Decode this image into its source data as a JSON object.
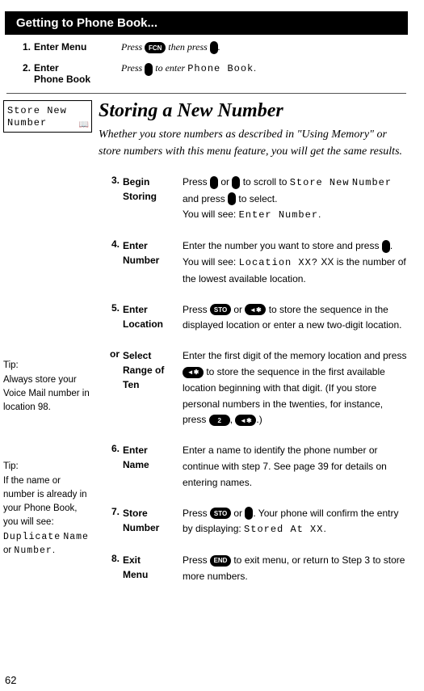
{
  "header": {
    "title": "Getting to Phone Book..."
  },
  "intro_steps": [
    {
      "num": "1.",
      "label": "Enter Menu",
      "desc_pre": "Press ",
      "btn1": "FCN",
      "mid": " then press ",
      "end": "."
    },
    {
      "num": "2.",
      "label_line1": "Enter",
      "label_line2": "Phone Book",
      "desc_pre": "Press ",
      "mid": " to enter ",
      "lcd": "Phone Book",
      "end": "."
    }
  ],
  "sidebar": {
    "box_line1": "Store New",
    "box_line2": "Number",
    "book_icon": "book-icon"
  },
  "tips": {
    "tip1_title": "Tip:",
    "tip1_body": "Always store your Voice Mail number in location 98.",
    "tip2_title": "Tip:",
    "tip2_body_pre": "If the name or number is already in your Phone Book, you will see:",
    "tip2_lcd1": "Duplicate",
    "tip2_lcd2": "Name",
    "tip2_or": " or ",
    "tip2_lcd3": "Number",
    "tip2_body_end": "."
  },
  "main": {
    "title": "Storing a New Number",
    "subtitle": "Whether you store numbers as described in \"Using Memory\" or store numbers with this menu feature, you will get the same results."
  },
  "steps": {
    "s3": {
      "num": "3.",
      "label1": "Begin",
      "label2": "Storing",
      "d1": "Press ",
      "d2": " or ",
      "d3": " to scroll to ",
      "lcd1": "Store New",
      "lcd2": "Number",
      "d4": " and press ",
      "d5": " to select.",
      "d6": "You will see: ",
      "lcd3": "Enter Number",
      "d7": "."
    },
    "s4": {
      "num": "4.",
      "label1": "Enter",
      "label2": "Number",
      "d1": "Enter the number you want to store and press ",
      "d2": ". You will see: ",
      "lcd1": "Location XX?",
      "d3": " XX is the number of the lowest available location."
    },
    "s5": {
      "num": "5.",
      "label1": "Enter",
      "label2": "Location",
      "d1": "Press ",
      "btn1": "STO",
      "d2": " or ",
      "btn2": "◄✱",
      "d3": " to store the sequence in the displayed location or enter a new two-digit location."
    },
    "sor": {
      "num": "or",
      "label1": "Select",
      "label2": "Range of",
      "label3": "Ten",
      "d1": "Enter the first digit of the memory location and press ",
      "btn1": "◄✱",
      "d2": " to store the sequence in the first available location beginning with that digit. (If you store personal numbers in the twenties, for instance, press ",
      "btn2": "2",
      "d3": ", ",
      "btn3": "◄✱",
      "d4": ".)"
    },
    "s6": {
      "num": "6.",
      "label1": "Enter",
      "label2": "Name",
      "d1": "Enter a name to identify the phone number or continue with step 7. See page 39 for details on entering names."
    },
    "s7": {
      "num": "7.",
      "label1": "Store",
      "label2": "Number",
      "d1": "Press ",
      "btn1": "STO",
      "d2": " or ",
      "d3": ". Your phone will confirm the entry by displaying: ",
      "lcd1": "Stored At XX",
      "d4": "."
    },
    "s8": {
      "num": "8.",
      "label1": "Exit",
      "label2": "Menu",
      "d1": "Press ",
      "btn1": "END",
      "d2": " to exit menu, or return to Step 3 to store more numbers."
    }
  },
  "page_number": "62"
}
